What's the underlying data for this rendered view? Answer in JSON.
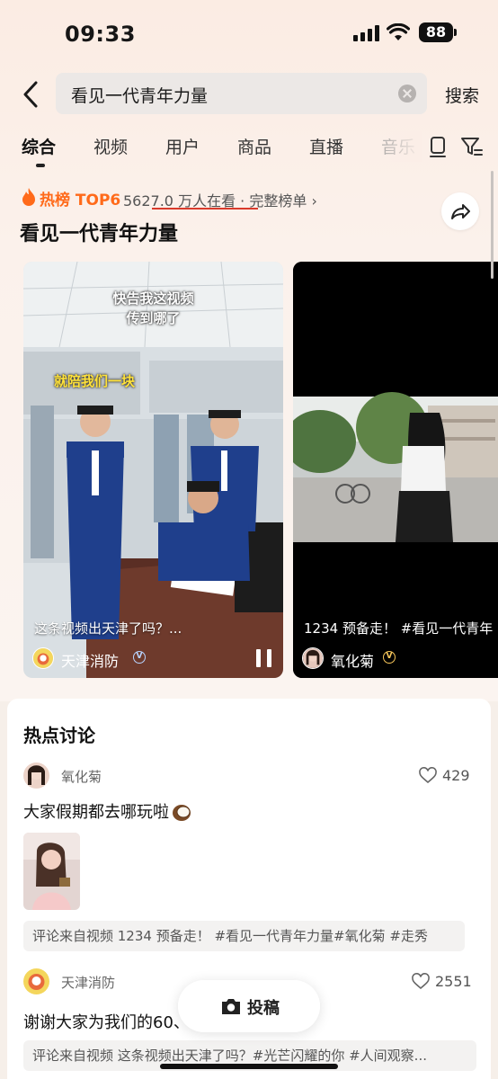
{
  "status_bar": {
    "time": "09:33",
    "battery": "88"
  },
  "search": {
    "query": "看见一代青年力量",
    "submit_label": "搜索"
  },
  "tabs": [
    {
      "label": "综合",
      "active": true
    },
    {
      "label": "视频"
    },
    {
      "label": "用户"
    },
    {
      "label": "商品"
    },
    {
      "label": "直播"
    },
    {
      "label": "音乐"
    }
  ],
  "hot": {
    "label": "热榜 TOP6",
    "viewers": "5627.0 万人在看",
    "full_list": "完整榜单",
    "title": "看见一代青年力量",
    "accent_color": "#ff6a1a"
  },
  "videos": [
    {
      "overlay_line1": "快告我这视频",
      "overlay_line2": "传到哪了",
      "overlay_highlight": "就陪我们一块",
      "caption": "这条视频出天津了吗？...",
      "author": "天津消防"
    },
    {
      "caption": "1234 预备走！ #看见一代青年",
      "author": "氧化菊"
    }
  ],
  "discussion": {
    "title": "热点讨论",
    "posts": [
      {
        "author": "氧化菊",
        "likes": "429",
        "text": "大家假期都去哪玩啦",
        "emoji": "coconut-emoji",
        "source": "评论来自视频 1234 预备走！ #看见一代青年力量#氧化菊 #走秀"
      },
      {
        "author": "天津消防",
        "likes": "2551",
        "text": "谢谢大家为我们的60、",
        "source": "评论来自视频 这条视频出天津了吗？#光芒闪耀的你 #人间观察..."
      }
    ]
  },
  "post_button": {
    "label": "投稿"
  }
}
